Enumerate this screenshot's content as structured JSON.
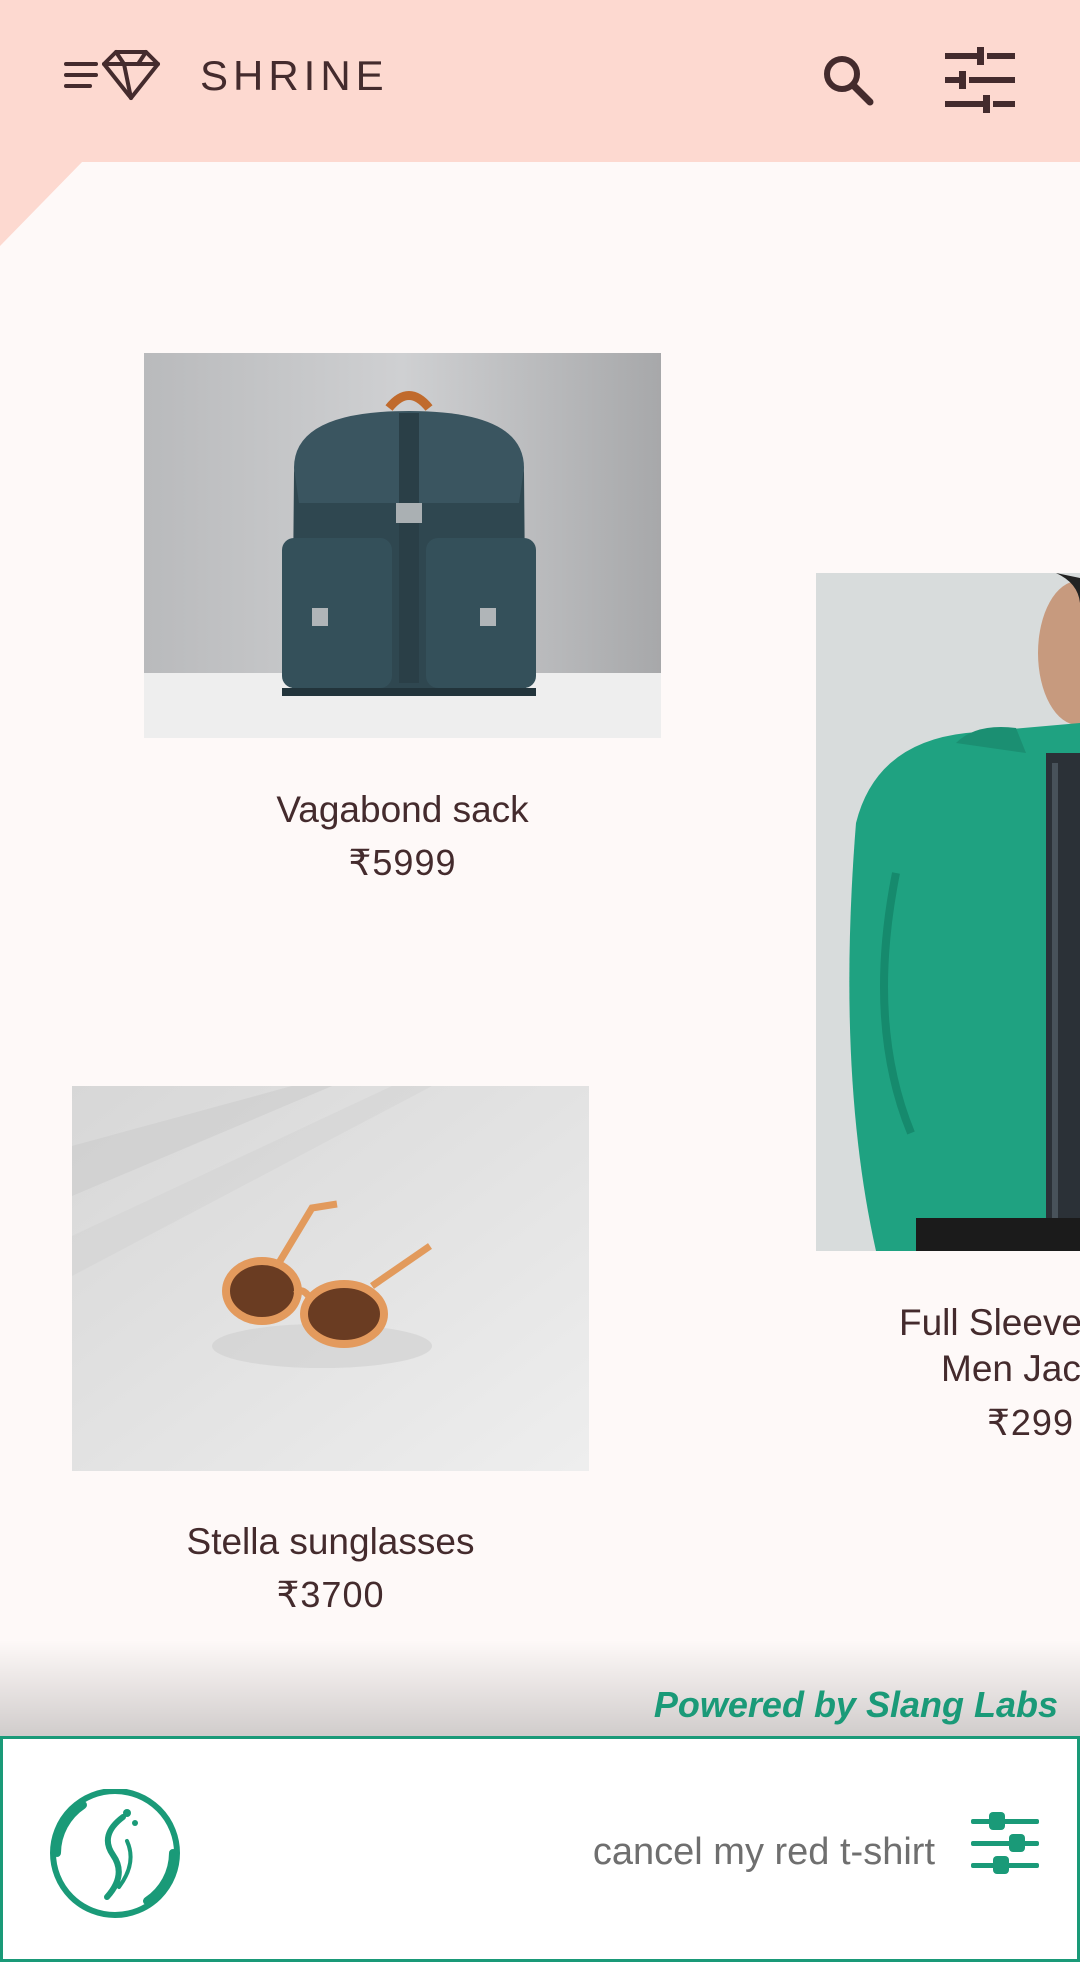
{
  "app": {
    "brand": "SHRINE"
  },
  "header": {
    "menu_icon": "menu-diamond-icon",
    "search_icon": "search-icon",
    "filter_icon": "tune-icon"
  },
  "products": [
    {
      "name": "Vagabond sack",
      "price": "₹5999",
      "image": "backpack"
    },
    {
      "name": "Full Sleeve\nMen Jac",
      "name_line1": "Full Sleeve",
      "name_line2": "Men Jac",
      "price": "₹299",
      "image": "jacket"
    },
    {
      "name": "Stella sunglasses",
      "price": "₹3700",
      "image": "sunglasses"
    }
  ],
  "slang": {
    "powered_by": "Powered by Slang Labs",
    "utterance": "cancel my red t-shirt",
    "logo_icon": "slang-logo-icon",
    "settings_icon": "sliders-icon"
  },
  "colors": {
    "header_bg": "#fdd9d0",
    "page_bg": "#fef9f8",
    "text": "#442b2d",
    "slang_accent": "#1a9a78"
  }
}
